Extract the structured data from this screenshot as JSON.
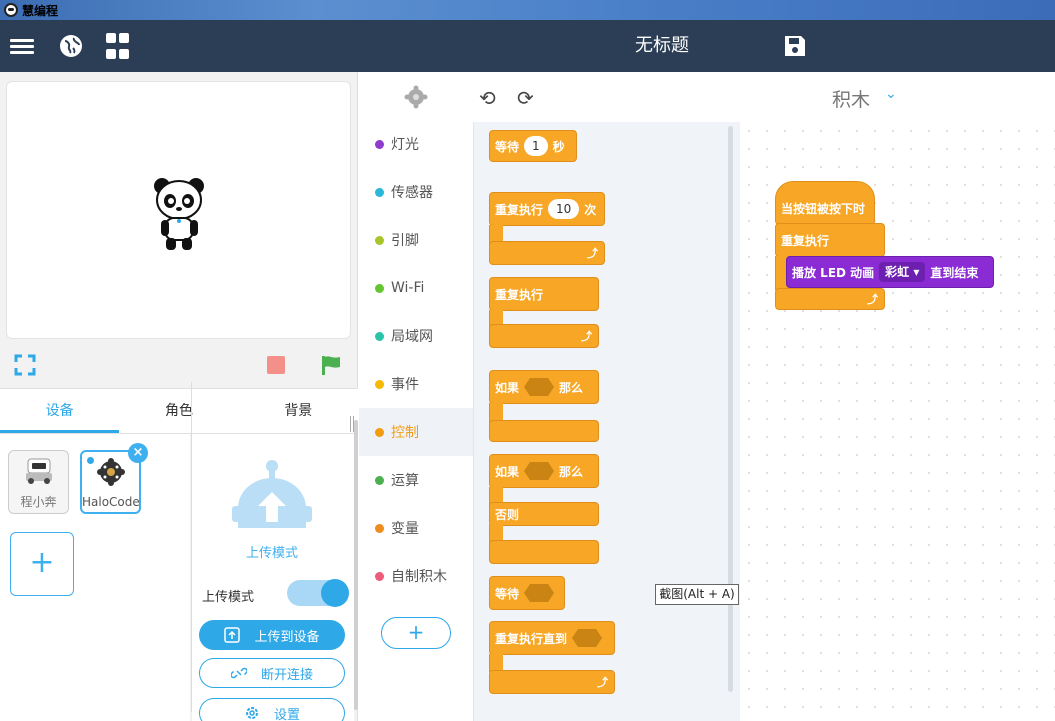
{
  "window": {
    "title": "慧编程"
  },
  "header": {
    "project_title": "无标题"
  },
  "stage_tabs": [
    {
      "label": "设备"
    },
    {
      "label": "角色"
    },
    {
      "label": "背景"
    }
  ],
  "devices": [
    {
      "label": "程小奔"
    },
    {
      "label": "HaloCode"
    }
  ],
  "mode_panel": {
    "title": "上传模式",
    "toggle_label": "上传模式",
    "upload_button": "上传到设备",
    "disconnect_button": "断开连接",
    "settings_button": "设置"
  },
  "categories": [
    {
      "label": "灯光",
      "color": "#8e3ccf"
    },
    {
      "label": "传感器",
      "color": "#2ab7d8"
    },
    {
      "label": "引脚",
      "color": "#a8c62a"
    },
    {
      "label": "Wi-Fi",
      "color": "#64c52e"
    },
    {
      "label": "局域网",
      "color": "#2bc4a8"
    },
    {
      "label": "事件",
      "color": "#f6b800"
    },
    {
      "label": "控制",
      "color": "#f39c12"
    },
    {
      "label": "运算",
      "color": "#4caf50"
    },
    {
      "label": "变量",
      "color": "#f08c1e"
    },
    {
      "label": "自制积木",
      "color": "#ef5b7a"
    }
  ],
  "palette": {
    "wait": "等待",
    "wait_value": "1",
    "wait_unit": "秒",
    "repeat": "重复执行",
    "repeat_value": "10",
    "repeat_unit": "次",
    "forever": "重复执行",
    "if": "如果",
    "then": "那么",
    "if2": "如果",
    "then2": "那么",
    "else": "否则",
    "wait_until": "等待",
    "repeat_until": "重复执行直到"
  },
  "workspace": {
    "title": "积木",
    "hat": "当按钮被按下时",
    "forever": "重复执行",
    "play": "播放 LED 动画",
    "anim": "彩虹",
    "until_done": "直到结束"
  },
  "tooltip": "截图(Alt + A)"
}
